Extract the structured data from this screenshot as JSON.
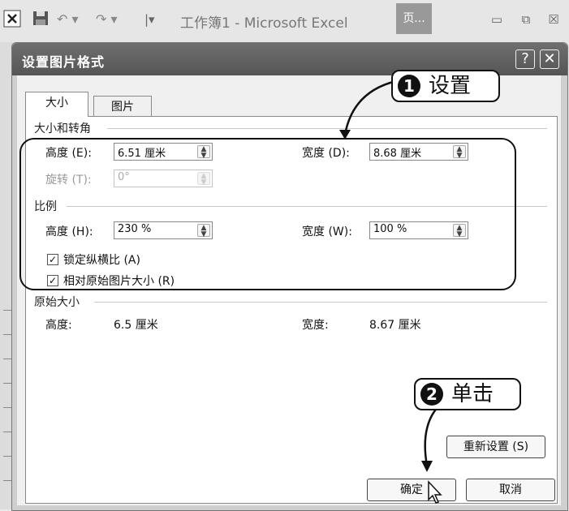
{
  "app": {
    "title": "工作簿1 - Microsoft Excel",
    "ribbon_tab": "页...",
    "icons": [
      "excel-icon",
      "save-icon",
      "undo-icon",
      "redo-icon",
      "customize-icon"
    ],
    "min": "▭",
    "restore": "⧉",
    "close": "☒"
  },
  "dialog": {
    "title": "设置图片格式",
    "help": "?",
    "close": "✕",
    "tabs": [
      {
        "label": "大小"
      },
      {
        "label": "图片"
      }
    ],
    "size_rotate": {
      "section": "大小和转角",
      "height_label": "高度 (E):",
      "height_value": "6.51 厘米",
      "width_label": "宽度 (D):",
      "width_value": "8.68 厘米",
      "rotate_label": "旋转 (T):",
      "rotate_value": "0°"
    },
    "scale": {
      "section": "比例",
      "height_label": "高度 (H):",
      "height_value": "230 %",
      "width_label": "宽度 (W):",
      "width_value": "100 %",
      "lock_ratio": "锁定纵横比 (A)",
      "relative_original": "相对原始图片大小 (R)"
    },
    "original": {
      "section": "原始大小",
      "height_label": "高度:",
      "height_value": "6.5 厘米",
      "width_label": "宽度:",
      "width_value": "8.67 厘米"
    },
    "reset_button": "重新设置 (S)",
    "ok_button": "确定",
    "cancel_button": "取消"
  },
  "annotations": {
    "step1_num": "1",
    "step1_text": "设置",
    "step2_num": "2",
    "step2_text": "单击"
  }
}
